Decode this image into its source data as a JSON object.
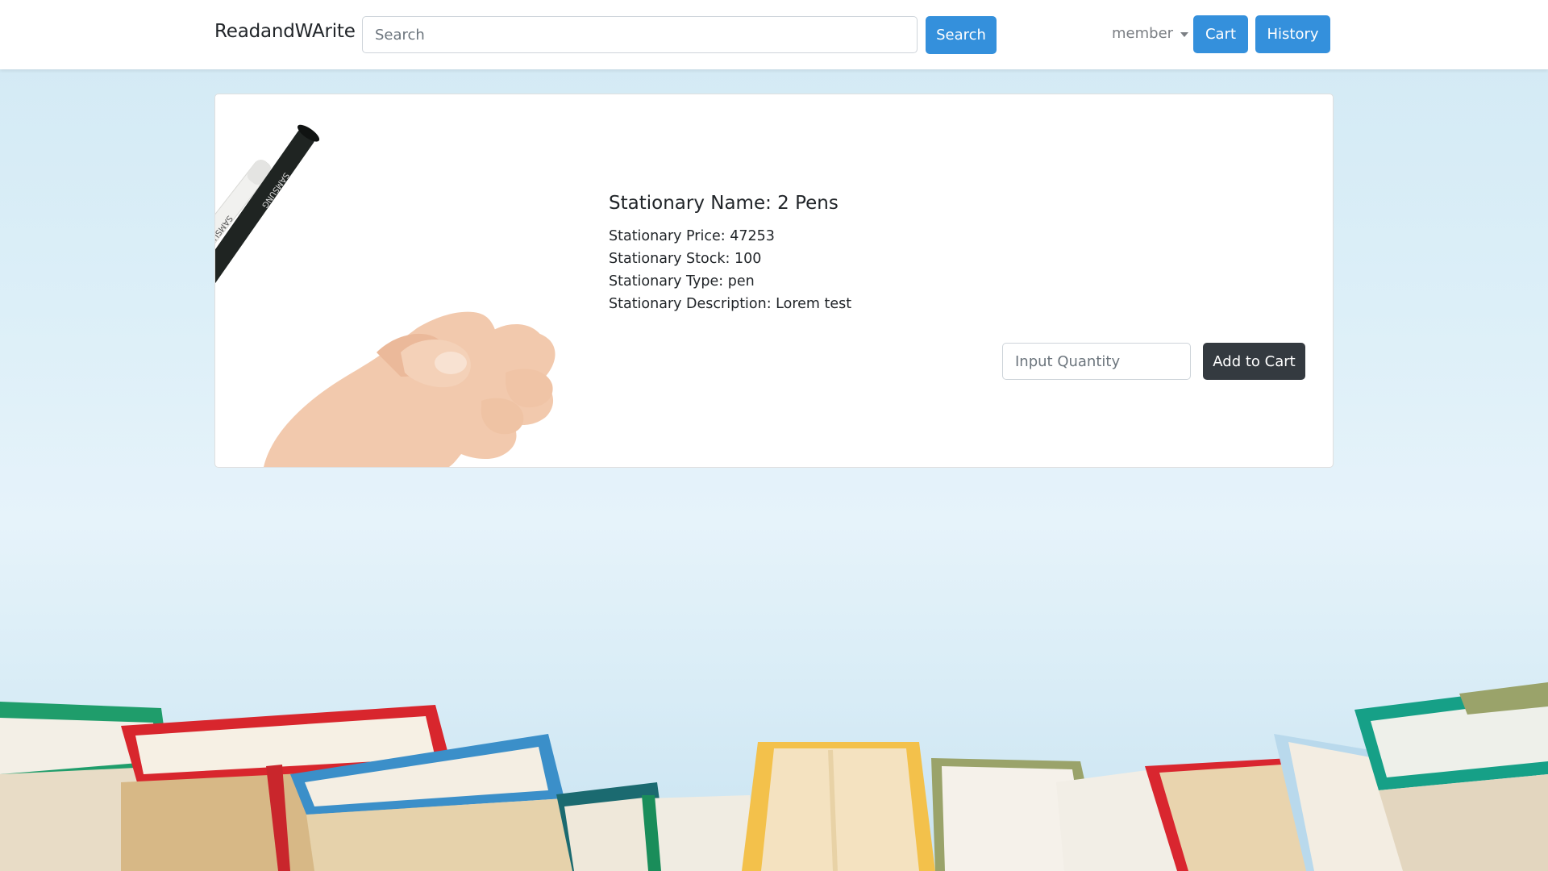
{
  "navbar": {
    "brand": "ReadandWArite",
    "search_placeholder": "Search",
    "search_button": "Search",
    "member_label": "member",
    "cart_button": "Cart",
    "history_button": "History"
  },
  "product": {
    "name_line": "Stationary Name: 2 Pens",
    "price_line": "Stationary Price: 47253",
    "stock_line": "Stationary Stock: 100",
    "type_line": "Stationary Type: pen",
    "description_line": "Stationary Description: Lorem test",
    "image_brand_text": "SAMSUNG",
    "quantity_placeholder": "Input Quantity",
    "add_to_cart_button": "Add to Cart"
  },
  "colors": {
    "primary": "#3490dc",
    "dark_button": "#343a40",
    "background_sky": "#dceff8"
  },
  "icons": {
    "member_caret": "caret-down-icon"
  }
}
